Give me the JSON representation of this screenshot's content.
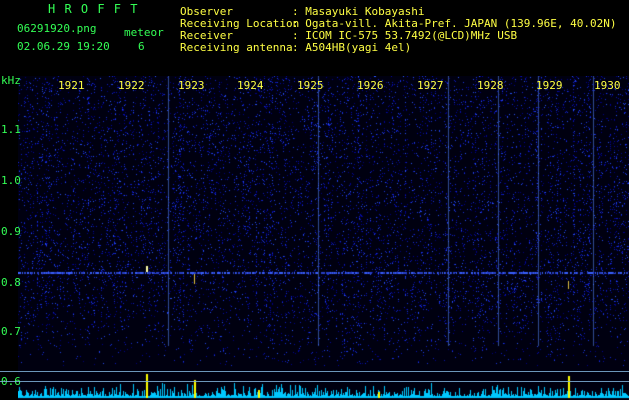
{
  "header": {
    "app_title": "H R O F F T",
    "file_name": "06291920.png",
    "meteor_label": "meteor",
    "datetime": "02.06.29 19:20",
    "meteor_count": "6",
    "observer_label": "Observer",
    "observer_value": ": Masayuki Kobayashi",
    "location_label": "Receiving Location",
    "location_value": ": Ogata-vill. Akita-Pref. JAPAN (139.96E, 40.02N)",
    "receiver_label": "Receiver",
    "receiver_value": ": ICOM IC-575 53.7492(@LCD)MHz USB",
    "antenna_label": "Receiving antenna",
    "antenna_value": ": A504HB(yagi 4el)"
  },
  "x_axis": {
    "ticks": [
      "1921",
      "1922",
      "1923",
      "1924",
      "1925",
      "1926",
      "1927",
      "1928",
      "1929",
      "1930"
    ]
  },
  "y_axis": {
    "unit": "kHz",
    "ticks": [
      "1.1",
      "1.0",
      "0.9",
      "0.8",
      "0.7",
      "0.6"
    ]
  },
  "colors": {
    "background": "#000000",
    "text_green": "#33ff55",
    "text_yellow": "#ffff44",
    "spectrum_blue": "#2a3fd0",
    "signal_line": "#3a60ff",
    "meteor_spike": "#ffff00",
    "noise_trace": "#00d8ff"
  }
}
